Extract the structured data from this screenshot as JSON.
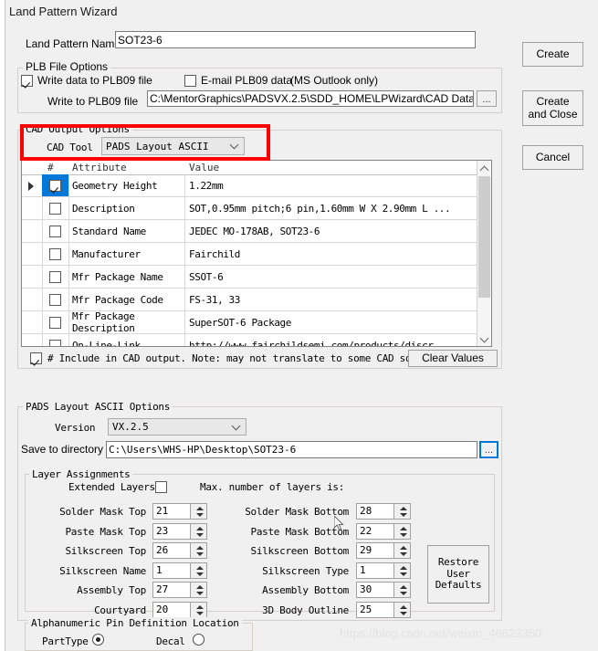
{
  "window": {
    "title": "Land Pattern Wizard"
  },
  "land_pattern": {
    "label": "Land Pattern Name",
    "value": "SOT23-6"
  },
  "plb": {
    "group_title": "PLB File Options",
    "write_data_label": "Write data to PLB09 file",
    "write_data_checked": true,
    "email_label": "E-mail PLB09 data",
    "email_note": "(MS Outlook only)",
    "email_checked": false,
    "write_to_label": "Write to PLB09 file",
    "write_to_value": "C:\\MentorGraphics\\PADSVX.2.5\\SDD_HOME\\LPWizard\\CAD Data\\Wiza",
    "browse_label": "..."
  },
  "cad_output": {
    "group_title": "CAD Output Options",
    "cad_tool_label": "CAD Tool",
    "cad_tool_value": "PADS Layout ASCII",
    "highlight_color": "#ff0000",
    "table": {
      "columns": [
        "#",
        "Attribute",
        "Value"
      ],
      "rows": [
        {
          "checked": true,
          "selected": true,
          "attribute": "Geometry Height",
          "value": "1.22mm"
        },
        {
          "checked": false,
          "selected": false,
          "attribute": "Description",
          "value": "SOT,0.95mm pitch;6 pin,1.60mm W X 2.90mm L ..."
        },
        {
          "checked": false,
          "selected": false,
          "attribute": "Standard Name",
          "value": "JEDEC MO-178AB, SOT23-6"
        },
        {
          "checked": false,
          "selected": false,
          "attribute": "Manufacturer",
          "value": "Fairchild"
        },
        {
          "checked": false,
          "selected": false,
          "attribute": "Mfr Package Name",
          "value": "SSOT-6"
        },
        {
          "checked": false,
          "selected": false,
          "attribute": "Mfr Package Code",
          "value": "FS-31, 33"
        },
        {
          "checked": false,
          "selected": false,
          "attribute": "Mfr Package Description",
          "value": "SuperSOT-6 Package"
        },
        {
          "checked": false,
          "selected": false,
          "attribute": "On-Line-Link",
          "value": "http://www.fairchildsemi.com/products/discr"
        }
      ]
    },
    "include_checked": true,
    "include_note": "# Include in CAD output.  Note: may not translate to some CAD sof",
    "clear_values_label": "Clear Values"
  },
  "pads_options": {
    "group_title": "PADS Layout ASCII Options",
    "version_label": "Version",
    "version_value": "VX.2.5",
    "save_dir_label": "Save to directory",
    "save_dir_value": "C:\\Users\\WHS-HP\\Desktop\\SOT23-6",
    "save_dir_browse": "..."
  },
  "layers": {
    "group_title": "Layer Assignments",
    "extended_label": "Extended Layers",
    "extended_checked": false,
    "max_layers_label": "Max. number of layers is:",
    "left": [
      {
        "label": "Solder Mask Top",
        "value": "21"
      },
      {
        "label": "Paste Mask Top",
        "value": "23"
      },
      {
        "label": "Silkscreen Top",
        "value": "26"
      },
      {
        "label": "Silkscreen Name",
        "value": "1"
      },
      {
        "label": "Assembly Top",
        "value": "27"
      },
      {
        "label": "Courtyard",
        "value": "20"
      }
    ],
    "right": [
      {
        "label": "Solder Mask Bottom",
        "value": "28"
      },
      {
        "label": "Paste Mask Bottom",
        "value": "22"
      },
      {
        "label": "Silkscreen Bottom",
        "value": "29"
      },
      {
        "label": "Silkscreen Type",
        "value": "1"
      },
      {
        "label": "Assembly  Bottom",
        "value": "30"
      },
      {
        "label": "3D Body Outline",
        "value": "25"
      }
    ],
    "restore_label": "Restore\nUser\nDefaults"
  },
  "pin_def": {
    "group_title": "Alphanumeric Pin Definition Location",
    "parttype_label": "PartType",
    "parttype_selected": true,
    "decal_label": "Decal",
    "decal_selected": false
  },
  "buttons": {
    "create": "Create",
    "create_and_close": "Create\nand Close",
    "cancel": "Cancel"
  },
  "watermark": "https://blog.csdn.net/weixin_46623350"
}
